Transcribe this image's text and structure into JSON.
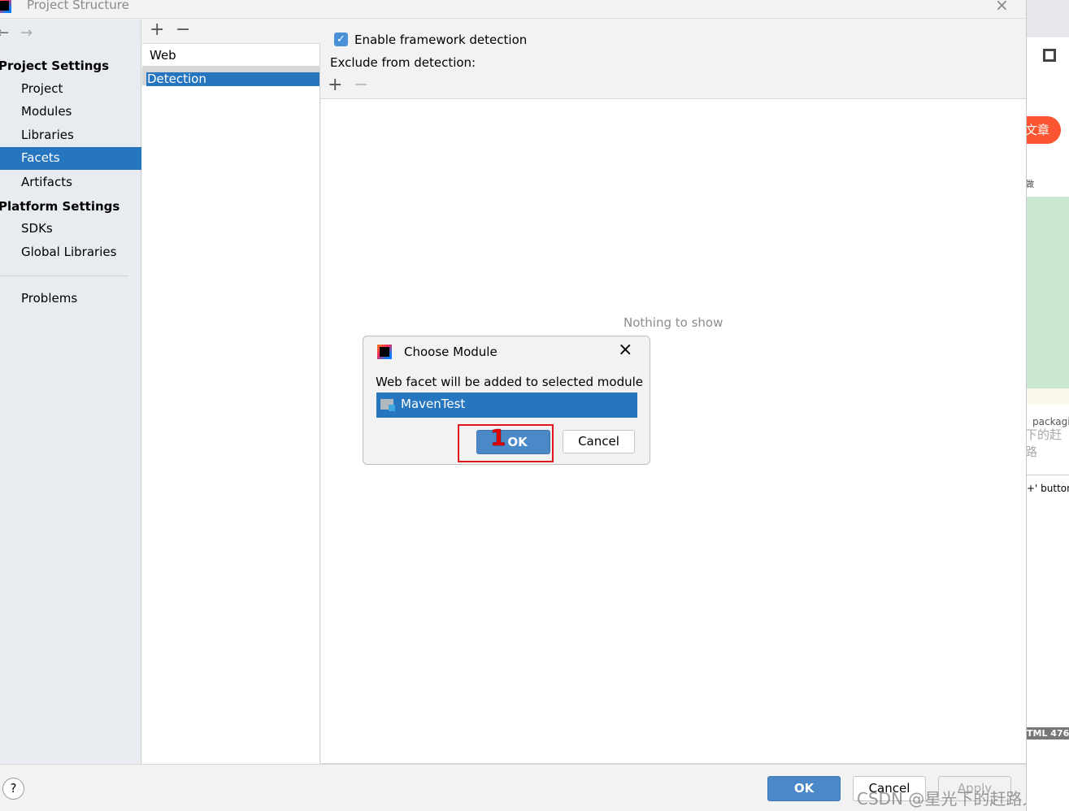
{
  "window": {
    "title": "Project Structure"
  },
  "sidebar": {
    "project_settings_header": "Project Settings",
    "project_items": [
      {
        "label": "Project"
      },
      {
        "label": "Modules"
      },
      {
        "label": "Libraries"
      },
      {
        "label": "Facets",
        "selected": true
      },
      {
        "label": "Artifacts"
      }
    ],
    "platform_settings_header": "Platform Settings",
    "platform_items": [
      {
        "label": "SDKs"
      },
      {
        "label": "Global Libraries"
      }
    ],
    "problems": "Problems"
  },
  "facets": {
    "items": [
      {
        "label": "Web"
      },
      {
        "label": "Detection",
        "selected": true
      }
    ]
  },
  "detection": {
    "enable_label": "Enable framework detection",
    "enable_checked": true,
    "exclude_label": "Exclude from detection:",
    "empty_text": "Nothing to show"
  },
  "dialog": {
    "title": "Choose Module",
    "message": "Web facet will be added to selected module",
    "module": "MavenTest",
    "ok": "OK",
    "cancel": "Cancel",
    "annotation": "1"
  },
  "footer": {
    "ok": "OK",
    "cancel": "Cancel",
    "apply": "Apply",
    "help": "?",
    "watermark": "CSDN @星光下的赶路人star"
  },
  "background_window": {
    "button": "文章",
    "redo": "做",
    "text1": "packagi",
    "text2": "下的赶路",
    "text3": "+' button",
    "status": "TML  476"
  },
  "colors": {
    "selection": "#2675bf",
    "ok_button": "#4a88c7",
    "annotation": "#e0141e"
  }
}
